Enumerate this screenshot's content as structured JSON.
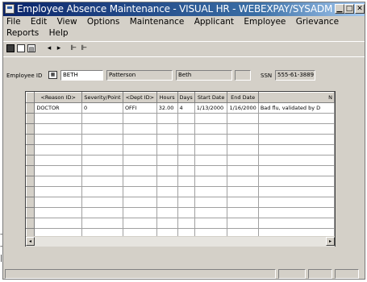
{
  "window": {
    "title": "Employee Absence Maintenance - VISUAL HR - WEBEXPAY/SYSADM",
    "controls": [
      "minimize",
      "maximize",
      "close"
    ]
  },
  "menu": {
    "row1": [
      "File",
      "Edit",
      "View",
      "Options",
      "Maintenance",
      "Applicant",
      "Employee",
      "Grievance"
    ],
    "row2": [
      "Reports",
      "Help"
    ]
  },
  "toolbar": {
    "icons": [
      "save-icon",
      "new-icon",
      "open-icon",
      "prev-icon",
      "next-icon",
      "first-icon",
      "last-icon"
    ]
  },
  "employee": {
    "id_label": "Employee ID",
    "id_value": "BETH",
    "last_name": "Patterson",
    "first_name": "Beth",
    "ssn_label": "SSN",
    "ssn_value": "555-61-3889"
  },
  "grid": {
    "columns": [
      "<Reason ID>",
      "Severity/Point",
      "<Dept ID>",
      "Hours",
      "Days",
      "Start Date",
      "End Date",
      "N"
    ],
    "rows": [
      [
        "DOCTOR",
        "0",
        "OFFI",
        "32.00",
        "4",
        "1/13/2000",
        "1/16/2000",
        "Bad flu, validated by D"
      ]
    ],
    "empty_rows": 13
  },
  "side_marks": [
    "-",
    "-",
    "|"
  ]
}
